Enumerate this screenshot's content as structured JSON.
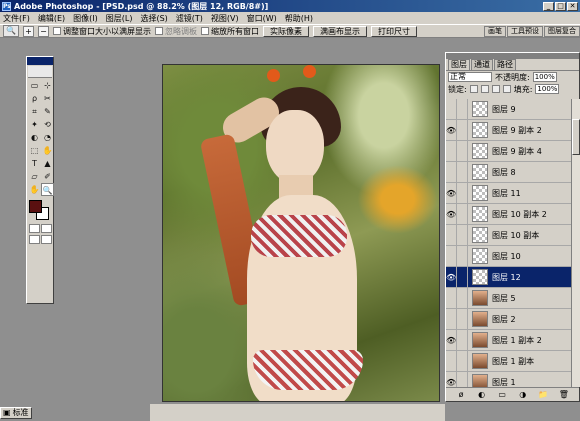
{
  "window": {
    "title": "Adobe Photoshop - [PSD.psd @ 88.2% (图层 12, RGB/8#)]",
    "buttons": [
      "_",
      "□",
      "✕"
    ]
  },
  "menubar": {
    "items": [
      "文件(F)",
      "编辑(E)",
      "图像(I)",
      "图层(L)",
      "选择(S)",
      "滤镜(T)",
      "视图(V)",
      "窗口(W)",
      "帮助(H)"
    ]
  },
  "options_bar": {
    "tool_preset_icon": "magnifier-icon",
    "zoom_in": "+",
    "zoom_out": "−",
    "check1_label": "调整窗口大小以满屏显示",
    "check2_label": "忽略调板",
    "check3_label": "缩放所有窗口",
    "btn_actual": "实际像素",
    "btn_fit": "满画布显示",
    "btn_print": "打印尺寸",
    "well_tabs": [
      "画笔",
      "工具预设",
      "图层复合"
    ]
  },
  "toolbox": {
    "tools": [
      "▭",
      "⊹",
      "ρ",
      "✂",
      "⌗",
      "✎",
      "✦",
      "⟲",
      "◐",
      "◔",
      "⬚",
      "✋",
      "T",
      "▲",
      "▱",
      "✐",
      "✋",
      "🔍"
    ],
    "foreground_color": "#5a1010",
    "background_color": "#ffffff"
  },
  "bottom_tabs": [
    "标准"
  ],
  "layers_panel": {
    "tabs": [
      "图层",
      "通道",
      "路径"
    ],
    "blend_mode": "正常",
    "opacity_label": "不透明度:",
    "opacity_value": "100%",
    "lock_label": "锁定:",
    "fill_label": "填充:",
    "fill_value": "100%",
    "layers": [
      {
        "name": "图层 9",
        "visible": false,
        "photo": false,
        "selected": false
      },
      {
        "name": "图层 9 副本 2",
        "visible": true,
        "photo": false,
        "selected": false
      },
      {
        "name": "图层 9 副本 4",
        "visible": false,
        "photo": false,
        "selected": false
      },
      {
        "name": "图层 8",
        "visible": false,
        "photo": false,
        "selected": false
      },
      {
        "name": "图层 11",
        "visible": true,
        "photo": false,
        "selected": false
      },
      {
        "name": "图层 10 副本 2",
        "visible": true,
        "photo": false,
        "selected": false
      },
      {
        "name": "图层 10 副本",
        "visible": false,
        "photo": false,
        "selected": false
      },
      {
        "name": "图层 10",
        "visible": false,
        "photo": false,
        "selected": false
      },
      {
        "name": "图层 12",
        "visible": true,
        "photo": false,
        "selected": true
      },
      {
        "name": "图层 5",
        "visible": false,
        "photo": true,
        "selected": false
      },
      {
        "name": "图层 2",
        "visible": false,
        "photo": true,
        "selected": false
      },
      {
        "name": "图层 1 副本 2",
        "visible": true,
        "photo": true,
        "selected": false
      },
      {
        "name": "图层 1 副本",
        "visible": false,
        "photo": true,
        "selected": false
      },
      {
        "name": "图层 1",
        "visible": true,
        "photo": true,
        "selected": false
      }
    ],
    "bottom_buttons": [
      "ø",
      "◐",
      "▭",
      "◑",
      "📁",
      "🗑"
    ]
  }
}
